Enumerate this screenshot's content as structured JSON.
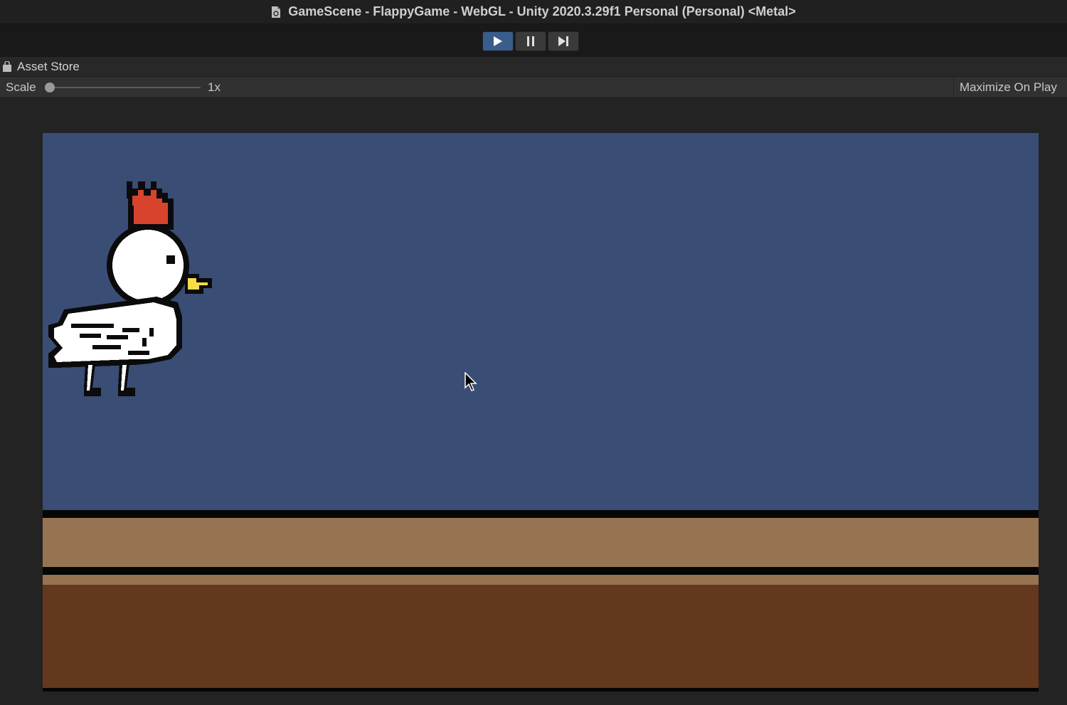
{
  "window": {
    "title": "GameScene - FlappyGame - WebGL - Unity 2020.3.29f1 Personal (Personal) <Metal>"
  },
  "playbar": {
    "play_icon": "play-icon",
    "pause_icon": "pause-icon",
    "step_icon": "step-icon",
    "play_active": true
  },
  "tab": {
    "label": "Asset Store",
    "icon": "bag-icon"
  },
  "scale": {
    "label": "Scale",
    "value": "1x",
    "slider_fraction": 0.0
  },
  "maximize": {
    "label": "Maximize On Play"
  },
  "game": {
    "colors": {
      "sky": "#3a4d75",
      "ground_top": "#977451",
      "dirt": "#64381c",
      "outline": "#060606"
    },
    "sprite": "chicken-sprite"
  }
}
